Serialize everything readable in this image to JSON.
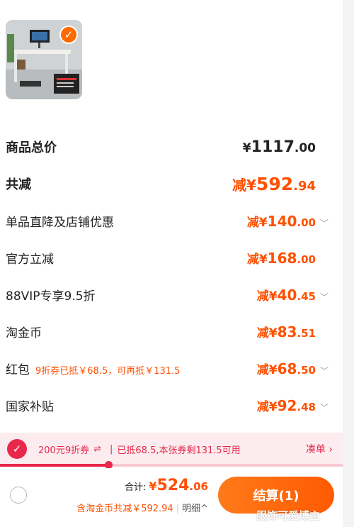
{
  "product": {
    "check_icon": "check-icon"
  },
  "summary": {
    "total_label": "商品总价",
    "total_value": {
      "prefix": "¥",
      "int": "1117",
      "dec": ".00"
    },
    "discount_label": "共减",
    "discount_value": {
      "prefix": "减¥",
      "int": "592",
      "dec": ".94"
    }
  },
  "discounts": [
    {
      "label": "单品直降及店铺优惠",
      "prefix": "减¥",
      "int": "140",
      "dec": ".00",
      "expandable": true
    },
    {
      "label": "官方立减",
      "prefix": "减¥",
      "int": "168",
      "dec": ".00",
      "expandable": false
    },
    {
      "label": "88VIP专享9.5折",
      "prefix": "减¥",
      "int": "40",
      "dec": ".45",
      "expandable": true
    },
    {
      "label": "淘金币",
      "prefix": "减¥",
      "int": "83",
      "dec": ".51",
      "expandable": false
    },
    {
      "label": "红包",
      "note": "9折券已抵￥68.5，可再抵￥131.5",
      "prefix": "减¥",
      "int": "68",
      "dec": ".50",
      "expandable": true
    },
    {
      "label": "国家补贴",
      "prefix": "减¥",
      "int": "92",
      "dec": ".48",
      "expandable": true
    }
  ],
  "coupon": {
    "name": "200元9折券",
    "swap_icon": "⇌",
    "status": "已抵68.5,本张券剩131.5可用",
    "link": "凑单 ›",
    "progress": 0.316,
    "accent": "#e8284a"
  },
  "footer": {
    "sum_label": "合计:",
    "sum_value": {
      "prefix": "¥",
      "int": "524",
      "dec": ".06"
    },
    "detail": "含淘金币共减￥592.94",
    "detail_link": "明细^",
    "checkout": "结算(1)",
    "watermark": "服饰可爱博主"
  },
  "colors": {
    "accent": "#ff5000",
    "coupon": "#e8284a"
  }
}
